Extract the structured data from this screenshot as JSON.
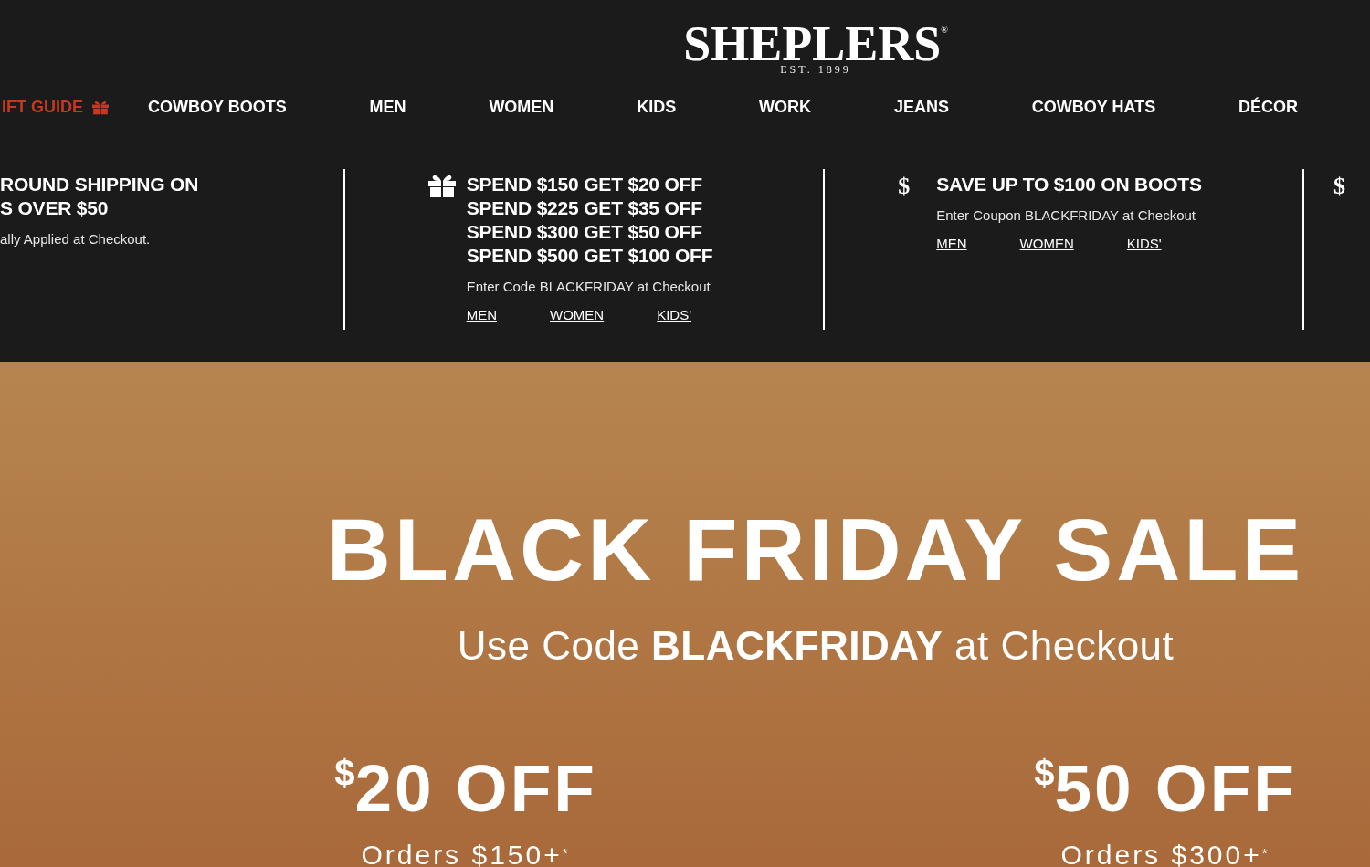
{
  "header": {
    "logo": {
      "wordmark": "SHEPLERS",
      "registered": "®",
      "tagline": "EST. 1899"
    },
    "nav": [
      {
        "label": "IFT GUIDE",
        "kind": "featured"
      },
      {
        "label": "COWBOY BOOTS",
        "kind": "link"
      },
      {
        "label": "MEN",
        "kind": "link"
      },
      {
        "label": "WOMEN",
        "kind": "link"
      },
      {
        "label": "KIDS",
        "kind": "link"
      },
      {
        "label": "WORK",
        "kind": "link"
      },
      {
        "label": "JEANS",
        "kind": "link"
      },
      {
        "label": "COWBOY HATS",
        "kind": "link"
      },
      {
        "label": "DÉCOR",
        "kind": "link"
      }
    ]
  },
  "promos": [
    {
      "kind": "plain",
      "headline": [
        "ROUND SHIPPING ON",
        "S OVER $50"
      ],
      "note": "ally Applied at Checkout."
    },
    {
      "kind": "gift",
      "headline": [
        "SPEND $150 GET $20 OFF",
        "SPEND $225 GET $35 OFF",
        "SPEND $300 GET $50 OFF",
        "SPEND $500 GET $100 OFF"
      ],
      "note": "Enter Code BLACKFRIDAY at Checkout",
      "links": [
        "MEN",
        "WOMEN",
        "KIDS'"
      ]
    },
    {
      "kind": "symbol",
      "symbol": "$",
      "headline": [
        "SAVE UP TO $100 ON BOOTS"
      ],
      "note": "Enter Coupon BLACKFRIDAY at Checkout",
      "links": [
        "MEN",
        "WOMEN",
        "KIDS'"
      ]
    },
    {
      "kind": "symbol",
      "symbol": "$"
    }
  ],
  "hero": {
    "title": "BLACK FRIDAY SALE",
    "subtitle": "Use Code **BLACKFRIDAY** at Checkout",
    "offers": [
      {
        "currency": "$",
        "amount": "20 OFF",
        "condition": "Orders $150+$^{*}$"
      },
      {
        "currency": "$",
        "amount": "50 OFF",
        "condition": "Orders $300+$^{*}$"
      }
    ]
  }
}
